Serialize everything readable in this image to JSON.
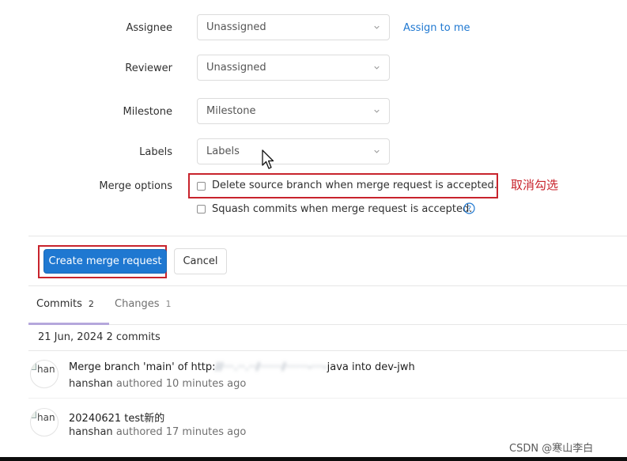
{
  "form": {
    "assignee": {
      "label": "Assignee",
      "value": "Unassigned",
      "assign_link": "Assign to me"
    },
    "reviewer": {
      "label": "Reviewer",
      "value": "Unassigned"
    },
    "milestone": {
      "label": "Milestone",
      "value": "Milestone"
    },
    "labels": {
      "label": "Labels",
      "value": "Labels"
    },
    "merge_options": {
      "label": "Merge options",
      "delete_source": {
        "text": "Delete source branch when merge request is accepted.",
        "checked": false
      },
      "squash": {
        "text": "Squash commits when merge request is accepted.",
        "checked": false,
        "help_icon": "question-circle-icon"
      }
    }
  },
  "annotation": {
    "text": "取消勾选",
    "color": "#c8232c"
  },
  "actions": {
    "create": "Create merge request",
    "cancel": "Cancel"
  },
  "tabs": [
    {
      "label": "Commits",
      "count": "2",
      "active": true
    },
    {
      "label": "Changes",
      "count": "1",
      "active": false
    }
  ],
  "commit_group": {
    "date": "21 Jun, 2024",
    "count": "2 commits"
  },
  "commits": [
    {
      "avatar_alt": "han",
      "title_prefix": "Merge branch 'main' of http:",
      "title_obscured": "//···.··.··/······/······-···-",
      "title_suffix": "java into dev-jwh",
      "author": "hanshan",
      "meta": "authored 10 minutes ago"
    },
    {
      "avatar_alt": "han",
      "title_prefix": "20240621 test新的",
      "title_obscured": "",
      "title_suffix": "",
      "author": "hanshan",
      "meta": "authored 17 minutes ago"
    }
  ],
  "watermark": "CSDN @寒山李白",
  "colors": {
    "primary": "#1f78d1",
    "annotation": "#c8232c",
    "tab_underline": "#b5a7dc"
  }
}
